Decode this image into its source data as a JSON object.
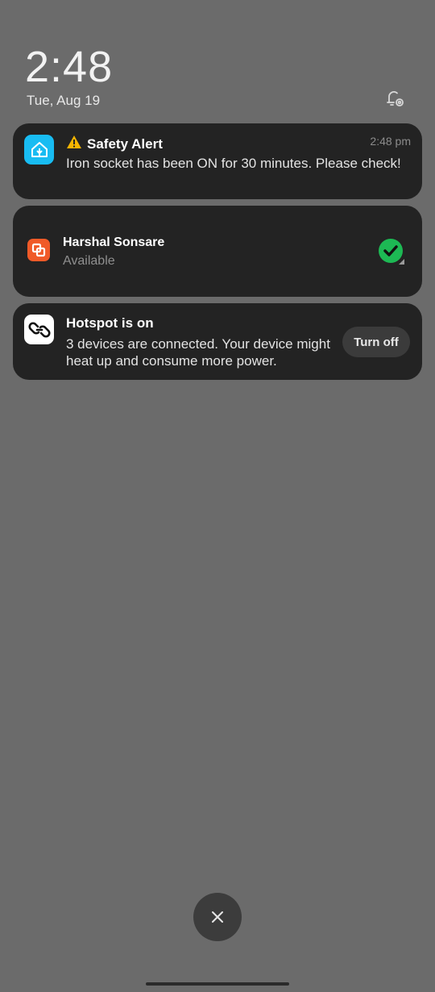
{
  "lockscreen": {
    "time": "2:48",
    "date": "Tue, Aug 19"
  },
  "notifications": [
    {
      "app_icon": "home-assistant-icon",
      "title_icon": "warning-icon",
      "title": "Safety Alert",
      "time": "2:48 pm",
      "body": "Iron socket has been ON for 30 minutes. Please check!"
    },
    {
      "app_icon": "anydesk-icon",
      "title": "Harshal Sonsare",
      "subtitle": "Available",
      "status_icon": "check-circle-icon"
    },
    {
      "app_icon": "hotspot-link-icon",
      "title": "Hotspot is on",
      "body": "3 devices are connected. Your device might heat up and consume more power.",
      "action_label": "Turn off"
    }
  ],
  "colors": {
    "background": "#6b6b6b",
    "card": "#232323",
    "accent_green": "#1db954",
    "home_icon": "#18bcf2",
    "anydesk": "#f05a28"
  }
}
